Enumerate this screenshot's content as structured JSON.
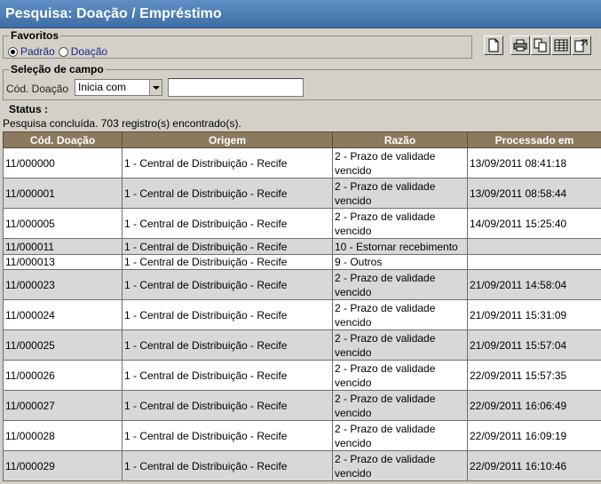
{
  "title": "Pesquisa: Doação / Empréstimo",
  "favoritos": {
    "legend": "Favoritos",
    "options": [
      {
        "label": "Padrão",
        "checked": true
      },
      {
        "label": "Doação",
        "checked": false
      }
    ]
  },
  "toolbar": {
    "icons": [
      "new-document-icon",
      "print-icon",
      "copy-icon",
      "columns-icon",
      "export-icon"
    ]
  },
  "selecao": {
    "legend": "Seleção de campo",
    "field_label": "Cód. Doação",
    "operator_value": "Inicia com",
    "search_value": ""
  },
  "status": {
    "label": "Status :",
    "text": "Pesquisa concluída. 703 registro(s) encontrado(s)."
  },
  "table": {
    "columns": [
      "Cód. Doação",
      "Origem",
      "Razão",
      "Processado em"
    ],
    "rows": [
      {
        "cod": "11/000000",
        "origem": "1 - Central de Distribuição - Recife",
        "razao": "2 - Prazo de validade vencido",
        "processado": "13/09/2011 08:41:18"
      },
      {
        "cod": "11/000001",
        "origem": "1 - Central de Distribuição - Recife",
        "razao": "2 - Prazo de validade vencido",
        "processado": "13/09/2011 08:58:44"
      },
      {
        "cod": "11/000005",
        "origem": "1 - Central de Distribuição - Recife",
        "razao": "2 - Prazo de validade vencido",
        "processado": "14/09/2011 15:25:40"
      },
      {
        "cod": "11/000011",
        "origem": "1 - Central de Distribuição - Recife",
        "razao": "10 - Estornar recebimento",
        "processado": ""
      },
      {
        "cod": "11/000013",
        "origem": "1 - Central de Distribuição - Recife",
        "razao": "9 - Outros",
        "processado": ""
      },
      {
        "cod": "11/000023",
        "origem": "1 - Central de Distribuição - Recife",
        "razao": "2 - Prazo de validade vencido",
        "processado": "21/09/2011 14:58:04"
      },
      {
        "cod": "11/000024",
        "origem": "1 - Central de Distribuição - Recife",
        "razao": "2 - Prazo de validade vencido",
        "processado": "21/09/2011 15:31:09"
      },
      {
        "cod": "11/000025",
        "origem": "1 - Central de Distribuição - Recife",
        "razao": "2 - Prazo de validade vencido",
        "processado": "21/09/2011 15:57:04"
      },
      {
        "cod": "11/000026",
        "origem": "1 - Central de Distribuição - Recife",
        "razao": "2 - Prazo de validade vencido",
        "processado": "22/09/2011 15:57:35"
      },
      {
        "cod": "11/000027",
        "origem": "1 - Central de Distribuição - Recife",
        "razao": "2 - Prazo de validade vencido",
        "processado": "22/09/2011 16:06:49"
      },
      {
        "cod": "11/000028",
        "origem": "1 - Central de Distribuição - Recife",
        "razao": "2 - Prazo de validade vencido",
        "processado": "22/09/2011 16:09:19"
      },
      {
        "cod": "11/000029",
        "origem": "1 - Central de Distribuição - Recife",
        "razao": "2 - Prazo de validade vencido",
        "processado": "22/09/2011 16:10:46"
      }
    ]
  }
}
